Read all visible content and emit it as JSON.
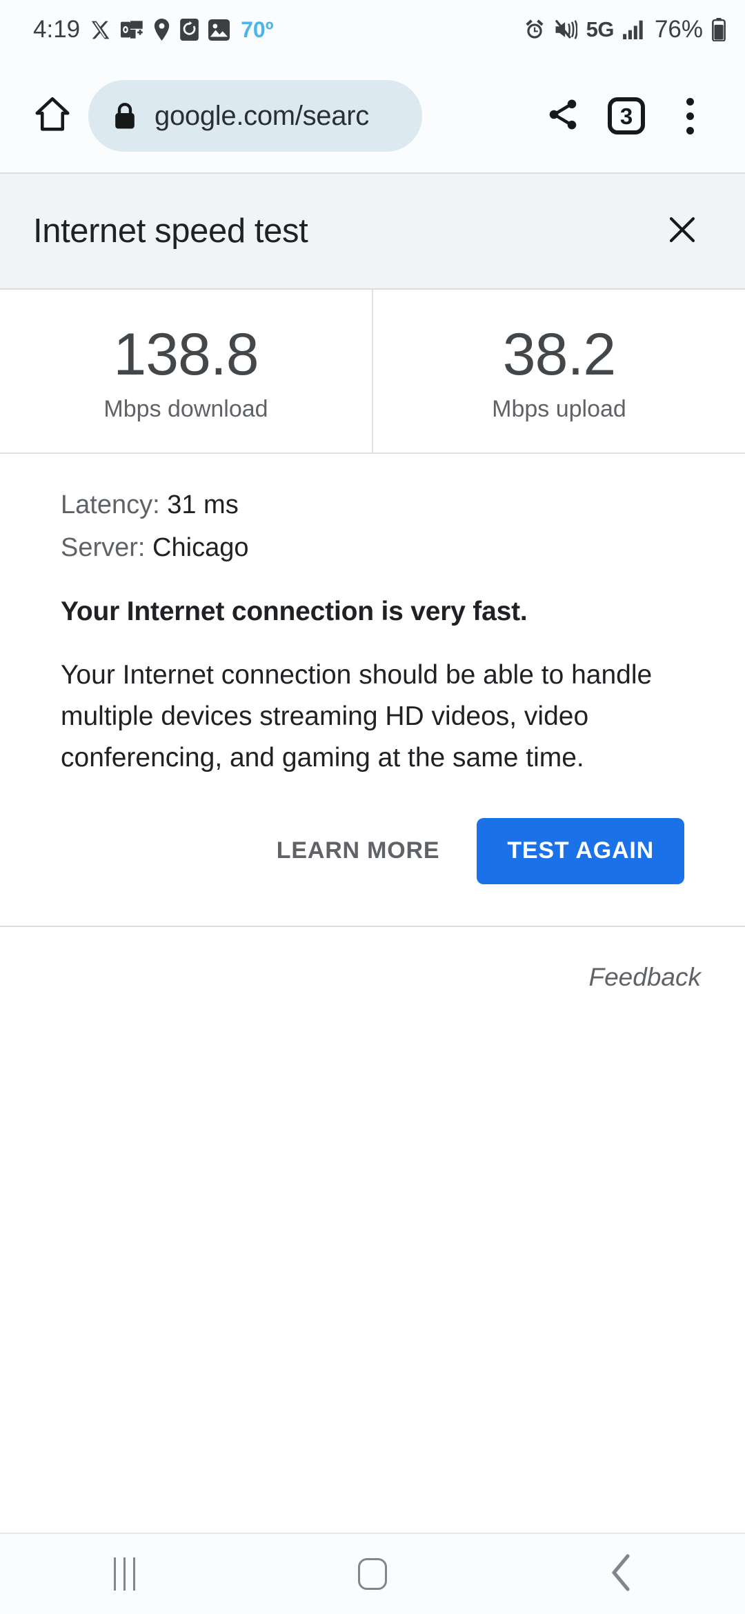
{
  "status_bar": {
    "time": "4:19",
    "temperature": "70º",
    "battery_percent": "76%",
    "network_type": "5G",
    "left_icons": [
      "x-twitter-icon",
      "outlook-icon",
      "location-pin-icon",
      "screen-timer-icon",
      "photos-icon"
    ],
    "right_icons": [
      "alarm-icon",
      "mute-vibrate-icon",
      "signal-bars-icon",
      "battery-icon"
    ]
  },
  "browser": {
    "home_icon": "home-icon",
    "lock_icon": "lock-icon",
    "url": "google.com/searc",
    "share_icon": "share-icon",
    "tab_count": "3",
    "menu_icon": "more-vertical-icon"
  },
  "panel": {
    "title": "Internet speed test",
    "close_icon": "close-icon"
  },
  "results": [
    {
      "value": "138.8",
      "label": "Mbps download"
    },
    {
      "value": "38.2",
      "label": "Mbps upload"
    }
  ],
  "details": {
    "latency_key": "Latency:",
    "latency_value": "31 ms",
    "server_key": "Server:",
    "server_value": "Chicago",
    "verdict": "Your Internet connection is very fast.",
    "description": "Your Internet connection should be able to handle multiple devices streaming HD videos, video conferencing, and gaming at the same time."
  },
  "actions": {
    "learn_more": "LEARN MORE",
    "test_again": "TEST AGAIN",
    "primary_color": "#1b72e8"
  },
  "feedback": {
    "label": "Feedback"
  },
  "nav_bar": {
    "recents_icon": "recents-icon",
    "home_icon": "home-button-icon",
    "back_icon": "back-chevron-icon"
  }
}
